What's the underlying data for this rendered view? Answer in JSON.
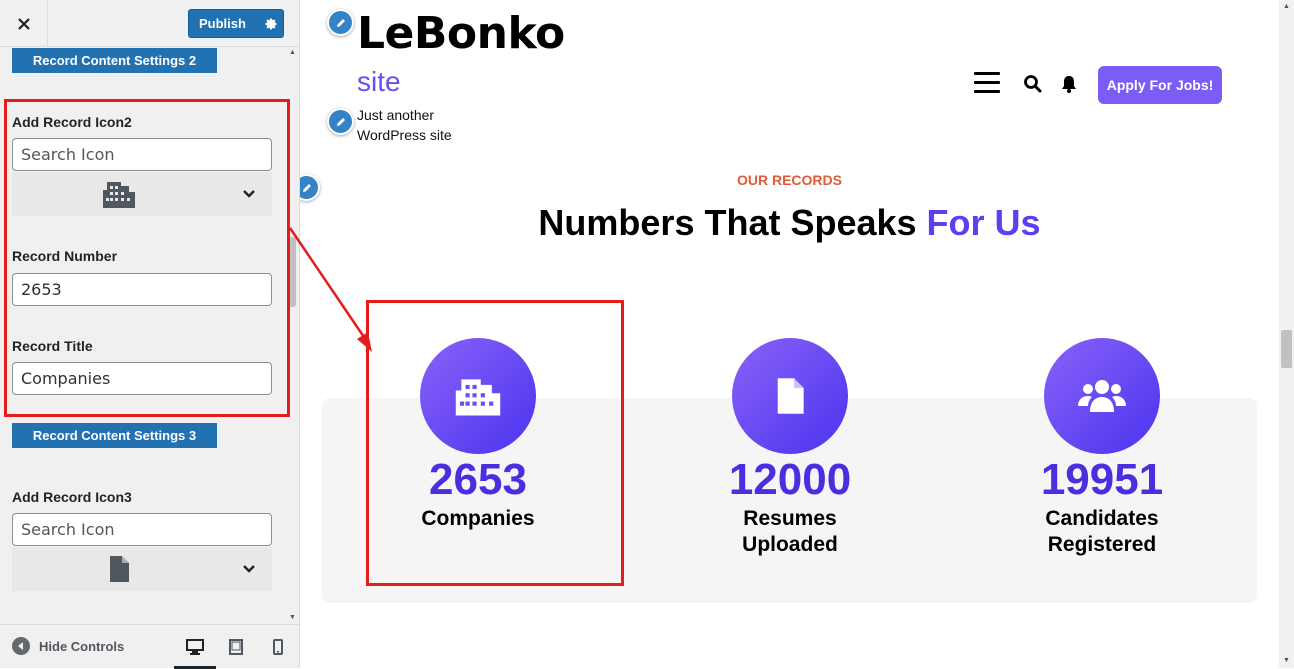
{
  "sidebar": {
    "close_icon": "close-icon",
    "publish_label": "Publish",
    "section_2_label": "Record Content Settings 2",
    "section_3_label": "Record Content Settings 3",
    "icon2_label": "Add Record Icon2",
    "icon2_search_placeholder": "Search Icon",
    "icon2_selected": "building-icon",
    "record_number_label": "Record Number",
    "record_number_value": "2653",
    "record_title_label": "Record Title",
    "record_title_value": "Companies",
    "icon3_label": "Add Record Icon3",
    "icon3_search_placeholder": "Search Icon",
    "icon3_selected": "file-icon",
    "hide_controls_label": "Hide Controls",
    "devices": [
      "desktop",
      "tablet",
      "mobile"
    ],
    "active_device": "desktop"
  },
  "site": {
    "logo_text": "LeBonko",
    "site_word": "site",
    "tagline": "Just another WordPress site",
    "apply_button": "Apply For Jobs!"
  },
  "records": {
    "eyebrow": "OUR RECORDS",
    "headline_main": "Numbers That Speaks ",
    "headline_accent": "For Us",
    "items": [
      {
        "icon": "building-icon",
        "number": "2653",
        "title": "Companies"
      },
      {
        "icon": "file-icon",
        "number": "12000",
        "title": "Resumes Uploaded"
      },
      {
        "icon": "users-icon",
        "number": "19951",
        "title": "Candidates Registered"
      }
    ]
  },
  "colors": {
    "wp_blue": "#2271b1",
    "accent_purple": "#5b3ff0",
    "button_purple": "#7b5cf5",
    "eyebrow_orange": "#e05a3a",
    "highlight_red": "#e61b1b"
  }
}
